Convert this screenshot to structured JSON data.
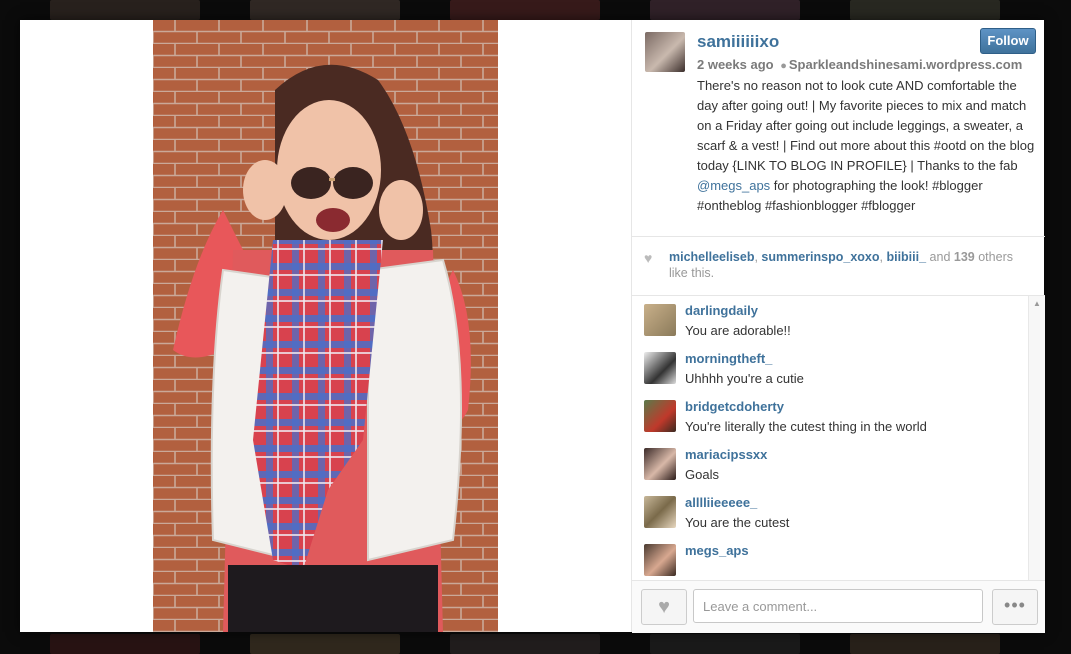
{
  "post": {
    "username": "samiiiiiixo",
    "follow_label": "Follow",
    "time": "2 weeks ago",
    "location": "Sparkleandshinesami.wordpress.com",
    "caption_parts": {
      "p1": "There's no reason not to look cute AND comfortable the day after going out! | My favorite pieces to mix and match on a Friday after going out include leggings, a sweater, a scarf & a vest! | Find out more about this #ootd on the blog today {LINK TO BLOG IN PROFILE} | Thanks to the fab ",
      "mention": "@megs_aps",
      "p2": " for photographing the look! ",
      "emoji": "",
      "p3": " #blogger #ontheblog #fashionblogger #fblogger"
    }
  },
  "likes": {
    "user1": "michelleeliseb",
    "user2": "summerinspo_xoxo",
    "user3": "biibiii_",
    "and": "and",
    "count": "139",
    "suffix": "others like this."
  },
  "comments": [
    {
      "user": "darlingdaily",
      "text": "You are adorable!!"
    },
    {
      "user": "morningtheft_",
      "text": "Uhhhh you're a cutie"
    },
    {
      "user": "bridgetcdoherty",
      "text": "You're literally the cutest thing in the world "
    },
    {
      "user": "mariacipssxx",
      "text": "Goals"
    },
    {
      "user": "alllliieeeee_",
      "text": "You are the cutest"
    },
    {
      "user": "megs_aps",
      "text": ""
    }
  ],
  "footer": {
    "comment_placeholder": "Leave a comment...",
    "more_label": "•••",
    "heart_label": "♥"
  },
  "icons": {
    "location": "location-pin-icon",
    "heart": "heart-icon",
    "more": "more-options-icon"
  },
  "colors": {
    "link_blue": "#3f729b",
    "follow_button": "#3f729b"
  }
}
